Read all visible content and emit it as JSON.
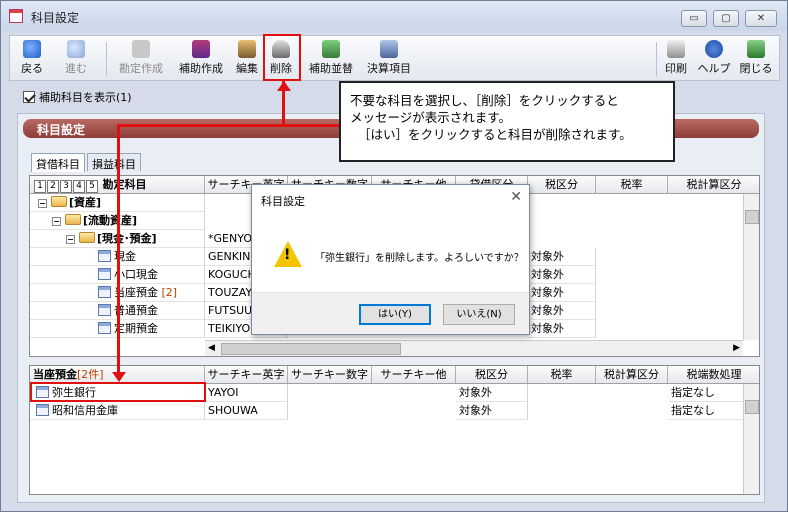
{
  "window": {
    "title": "科目設定"
  },
  "window_buttons": {
    "minimize": "▭",
    "maximize": "▢",
    "close": "✕"
  },
  "toolbar": {
    "back": "戻る",
    "forward": "進む",
    "add_subject": "勘定作成",
    "add_sub": "補助作成",
    "edit": "編集",
    "delete": "削除",
    "sort_sub": "補助並替",
    "closing": "決算項目",
    "print": "印刷",
    "help": "ヘルプ",
    "close": "閉じる"
  },
  "show_sub_checkbox": {
    "label": "補助科目を表示(1)",
    "checked": true
  },
  "section": {
    "title": "科目設定"
  },
  "tabs": [
    {
      "label": "貸借科目"
    },
    {
      "label": "損益科目"
    }
  ],
  "upper_grid": {
    "level_buttons": [
      "1",
      "2",
      "3",
      "4",
      "5"
    ],
    "headers": [
      "勘定科目",
      "サーチキー英字",
      "サーチキー数字",
      "サーチキー他",
      "貸借区分",
      "税区分",
      "税率",
      "税計算区分"
    ],
    "rows": [
      {
        "name": "[資産]",
        "search": "",
        "tax": ""
      },
      {
        "name": "[流動資産]",
        "search": "",
        "tax": ""
      },
      {
        "name": "[現金･預金]",
        "search": "*GENYO",
        "tax": ""
      },
      {
        "name": "現金",
        "search": "GENKIN",
        "tax": "対象外"
      },
      {
        "name": "小口現金",
        "search": "KOGUCH",
        "tax": "対象外"
      },
      {
        "name": "当座預金",
        "count": "[2]",
        "search": "TOUZAY",
        "tax": "対象外"
      },
      {
        "name": "普通預金",
        "search": "FUTSUU",
        "tax": "対象外"
      },
      {
        "name": "定期預金",
        "search": "TEIKIYO",
        "tax": "対象外"
      }
    ]
  },
  "lower_grid": {
    "title": "当座預金",
    "count": "[2件]",
    "headers": [
      "サーチキー英字",
      "サーチキー数字",
      "サーチキー他",
      "税区分",
      "税率",
      "税計算区分",
      "税端数処理"
    ],
    "rows": [
      {
        "name": "弥生銀行",
        "search": "YAYOI",
        "tax": "対象外",
        "rounding": "指定なし"
      },
      {
        "name": "昭和信用金庫",
        "search": "SHOUWA",
        "tax": "対象外",
        "rounding": "指定なし"
      }
    ]
  },
  "callout": {
    "line1": "不要な科目を選択し、［削除］をクリックすると",
    "line2": "メッセージが表示されます。",
    "line3": "［はい］をクリックすると科目が削除されます。"
  },
  "dialog": {
    "title": "科目設定",
    "message": "「弥生銀行」を削除します。よろしいですか？",
    "yes": "はい(Y)",
    "no": "いいえ(N)",
    "close": "✕"
  },
  "colors": {
    "highlight": "#e01010",
    "section_header": "#9c4a44"
  }
}
